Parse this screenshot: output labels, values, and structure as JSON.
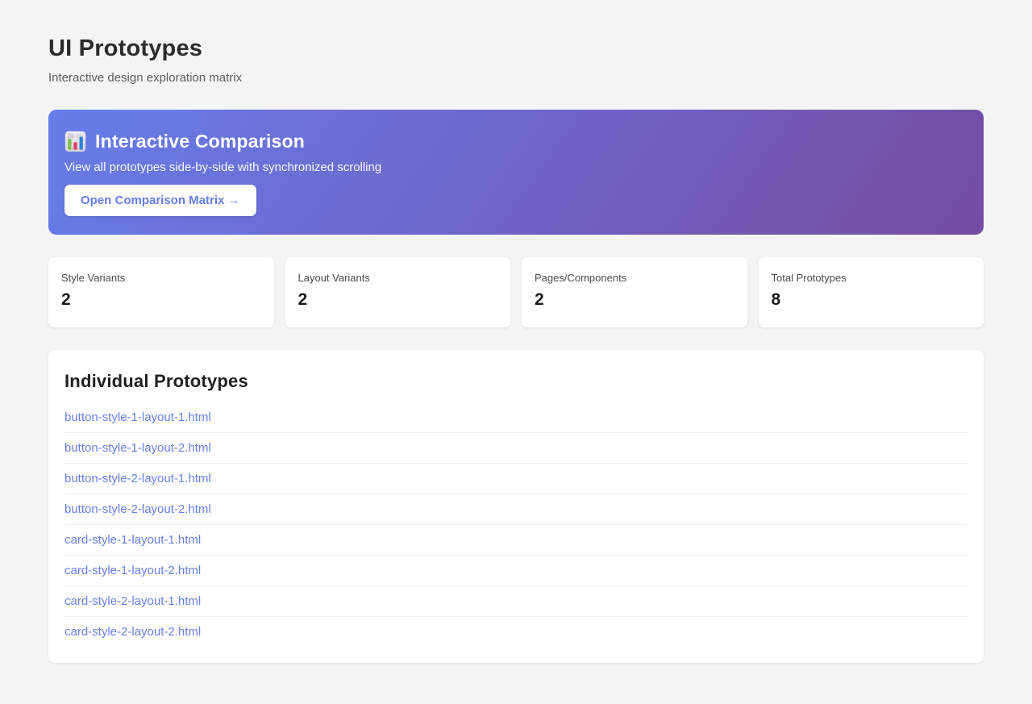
{
  "page": {
    "title": "UI Prototypes",
    "subtitle": "Interactive design exploration matrix"
  },
  "banner": {
    "icon": "bar-chart-icon",
    "title": "Interactive Comparison",
    "description": "View all prototypes side-by-side with synchronized scrolling",
    "button_label": "Open Comparison Matrix →",
    "gradient_start": "#667eea",
    "gradient_end": "#764ba2",
    "button_text_color": "#667eea"
  },
  "stats": [
    {
      "label": "Style Variants",
      "value": "2"
    },
    {
      "label": "Layout Variants",
      "value": "2"
    },
    {
      "label": "Pages/Components",
      "value": "2"
    },
    {
      "label": "Total Prototypes",
      "value": "8"
    }
  ],
  "prototypes": {
    "heading": "Individual Prototypes",
    "link_color": "#667eea",
    "links": [
      "button-style-1-layout-1.html",
      "button-style-1-layout-2.html",
      "button-style-2-layout-1.html",
      "button-style-2-layout-2.html",
      "card-style-1-layout-1.html",
      "card-style-1-layout-2.html",
      "card-style-2-layout-1.html",
      "card-style-2-layout-2.html"
    ]
  }
}
